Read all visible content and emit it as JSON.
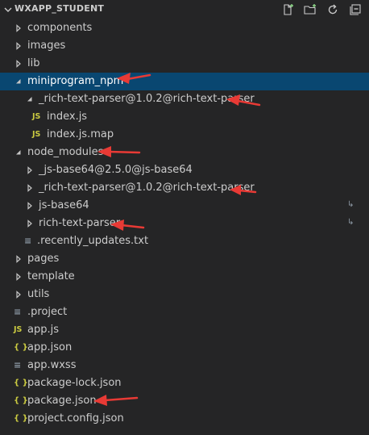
{
  "explorer": {
    "title": "WXAPP_STUDENT",
    "actions": [
      {
        "name": "new-file-icon"
      },
      {
        "name": "new-folder-icon"
      },
      {
        "name": "refresh-icon"
      },
      {
        "name": "collapse-all-icon"
      }
    ]
  },
  "tree": [
    {
      "label": "components",
      "type": "folder",
      "expanded": false
    },
    {
      "label": "images",
      "type": "folder",
      "expanded": false
    },
    {
      "label": "lib",
      "type": "folder",
      "expanded": false
    },
    {
      "label": "miniprogram_npm",
      "type": "folder",
      "expanded": true,
      "selected": true
    },
    {
      "label": "_rich-text-parser@1.0.2@rich-text-parser",
      "type": "folder",
      "expanded": true
    },
    {
      "label": "index.js",
      "type": "file",
      "icon": "JS"
    },
    {
      "label": "index.js.map",
      "type": "file",
      "icon": "JS"
    },
    {
      "label": "node_modules",
      "type": "folder",
      "expanded": true
    },
    {
      "label": "_js-base64@2.5.0@js-base64",
      "type": "folder",
      "expanded": false
    },
    {
      "label": "_rich-text-parser@1.0.2@rich-text-parser",
      "type": "folder",
      "expanded": false
    },
    {
      "label": "js-base64",
      "type": "folder",
      "expanded": false,
      "symlink": true
    },
    {
      "label": "rich-text-parser",
      "type": "folder",
      "expanded": false,
      "symlink": true
    },
    {
      "label": ".recently_updates.txt",
      "type": "file",
      "icon": "≡"
    },
    {
      "label": "pages",
      "type": "folder",
      "expanded": false
    },
    {
      "label": "template",
      "type": "folder",
      "expanded": false
    },
    {
      "label": "utils",
      "type": "folder",
      "expanded": false
    },
    {
      "label": ".project",
      "type": "file",
      "icon": "≡"
    },
    {
      "label": "app.js",
      "type": "file",
      "icon": "JS"
    },
    {
      "label": "app.json",
      "type": "file",
      "icon": "{}"
    },
    {
      "label": "app.wxss",
      "type": "file",
      "icon": "≡"
    },
    {
      "label": "package-lock.json",
      "type": "file",
      "icon": "{}"
    },
    {
      "label": "package.json",
      "type": "file",
      "icon": "{}"
    },
    {
      "label": "project.config.json",
      "type": "file",
      "icon": "{}"
    }
  ],
  "symlink_glyph": "↳",
  "colors": {
    "selection": "#094771",
    "arrow": "#e83a35",
    "js_icon": "#cbcb41"
  }
}
